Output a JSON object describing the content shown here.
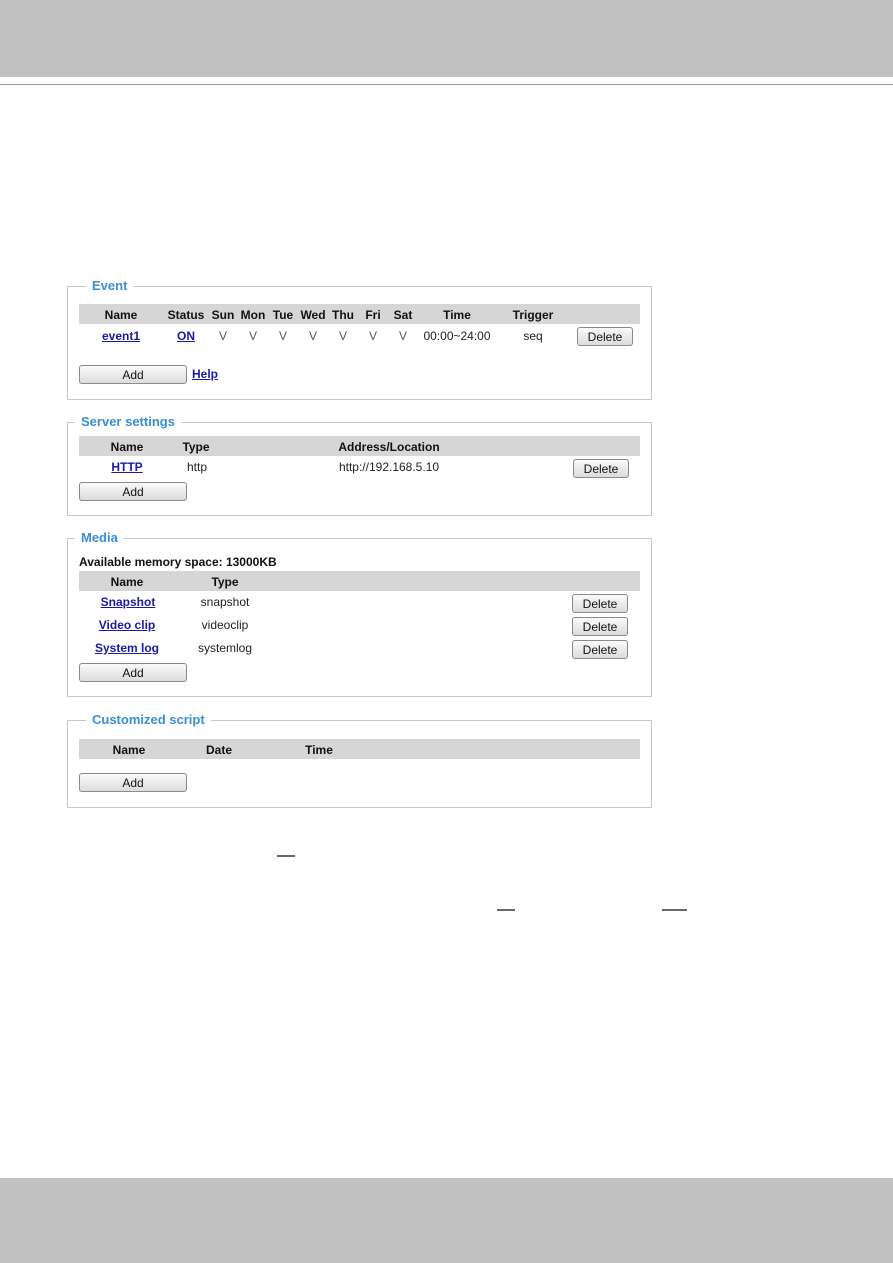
{
  "event": {
    "title": "Event",
    "headers": [
      "Name",
      "Status",
      "Sun",
      "Mon",
      "Tue",
      "Wed",
      "Thu",
      "Fri",
      "Sat",
      "Time",
      "Trigger"
    ],
    "rows": [
      {
        "name": "event1",
        "status": "ON",
        "days": [
          "V",
          "V",
          "V",
          "V",
          "V",
          "V",
          "V"
        ],
        "time": "00:00~24:00",
        "trigger": "seq",
        "delete": "Delete"
      }
    ],
    "add": "Add",
    "help": "Help"
  },
  "server": {
    "title": "Server settings",
    "headers": [
      "Name",
      "Type",
      "Address/Location"
    ],
    "rows": [
      {
        "name": "HTTP",
        "type": "http",
        "address": "http://192.168.5.10",
        "delete": "Delete"
      }
    ],
    "add": "Add"
  },
  "media": {
    "title": "Media",
    "memory": "Available memory space: 13000KB",
    "headers": [
      "Name",
      "Type"
    ],
    "rows": [
      {
        "name": "Snapshot",
        "type": "snapshot",
        "delete": "Delete"
      },
      {
        "name": "Video clip",
        "type": "videoclip",
        "delete": "Delete"
      },
      {
        "name": "System log",
        "type": "systemlog",
        "delete": "Delete"
      }
    ],
    "add": "Add"
  },
  "script": {
    "title": "Customized script",
    "headers": [
      "Name",
      "Date",
      "Time"
    ],
    "add": "Add"
  },
  "colors": {
    "legend": "#3a8fd0",
    "link": "#1a1aa6",
    "header_bg": "#d6d6d6",
    "bars": "#c1c1c1"
  }
}
